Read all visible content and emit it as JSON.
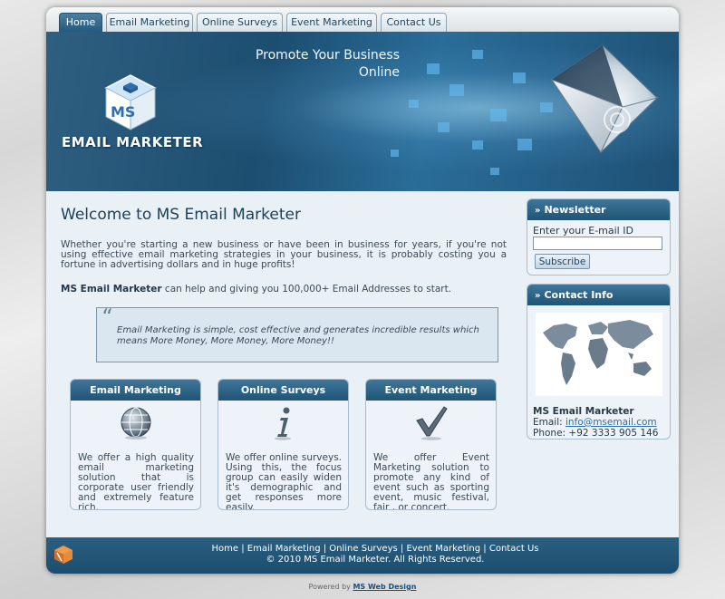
{
  "nav": {
    "tabs": [
      {
        "label": "Home",
        "active": true
      },
      {
        "label": "Email Marketing",
        "active": false
      },
      {
        "label": "Online Surveys",
        "active": false
      },
      {
        "label": "Event Marketing",
        "active": false
      },
      {
        "label": "Contact Us",
        "active": false
      }
    ]
  },
  "banner": {
    "slogan_line1": "Promote Your Business",
    "slogan_line2": "Online",
    "logo_letters": "MS",
    "logo_text": "EMAIL MARKETER",
    "envelope_icon": "envelope-icon"
  },
  "main": {
    "title": "Welcome to MS Email Marketer",
    "intro": "Whether you're starting a new business or have been in business for years, if you're not using effective email marketing strategies in your business, it is probably costing you a fortune in advertising dollars and in huge profits!",
    "help_bold": "MS Email Marketer",
    "help_rest": " can help and giving you 100,000+ Email Addresses to start.",
    "quote": "Email Marketing is simple, cost effective and generates incredible results which means More Money, More Money, More Money!!"
  },
  "features": [
    {
      "title": "Email Marketing",
      "icon": "globe-icon",
      "text": "We offer a high quality email marketing solution that is corporate user friendly and extremely feature rich."
    },
    {
      "title": "Online Surveys",
      "icon": "info-icon",
      "text": "We offer online surveys. Using this, the focus group can easily widen it's demographic and get responses more easily."
    },
    {
      "title": "Event Marketing",
      "icon": "checkmark-icon",
      "text": "We offer Event Marketing solution to promote any kind of event such as sporting event, music festival, fair , or concert."
    }
  ],
  "newsletter": {
    "title": "Newsletter",
    "label": "Enter your E-mail ID",
    "input_value": "",
    "button": "Subscribe"
  },
  "contact": {
    "title": "Contact Info",
    "name": "MS Email Marketer",
    "email_label": "Email: ",
    "email": "info@msemail.com",
    "phone": "Phone: +92 3333 905 146"
  },
  "footer": {
    "links": [
      "Home",
      "Email Marketing",
      "Online Surveys",
      "Event Marketing",
      "Contact Us"
    ],
    "copyright": "© 2010 MS Email Marketer. All Rights Reserved."
  },
  "powered": {
    "prefix": "Powered by ",
    "link": "MS Web Design"
  },
  "colors": {
    "accent": "#1f5476",
    "link": "#2a6fb0",
    "background": "#e9f0f6"
  }
}
